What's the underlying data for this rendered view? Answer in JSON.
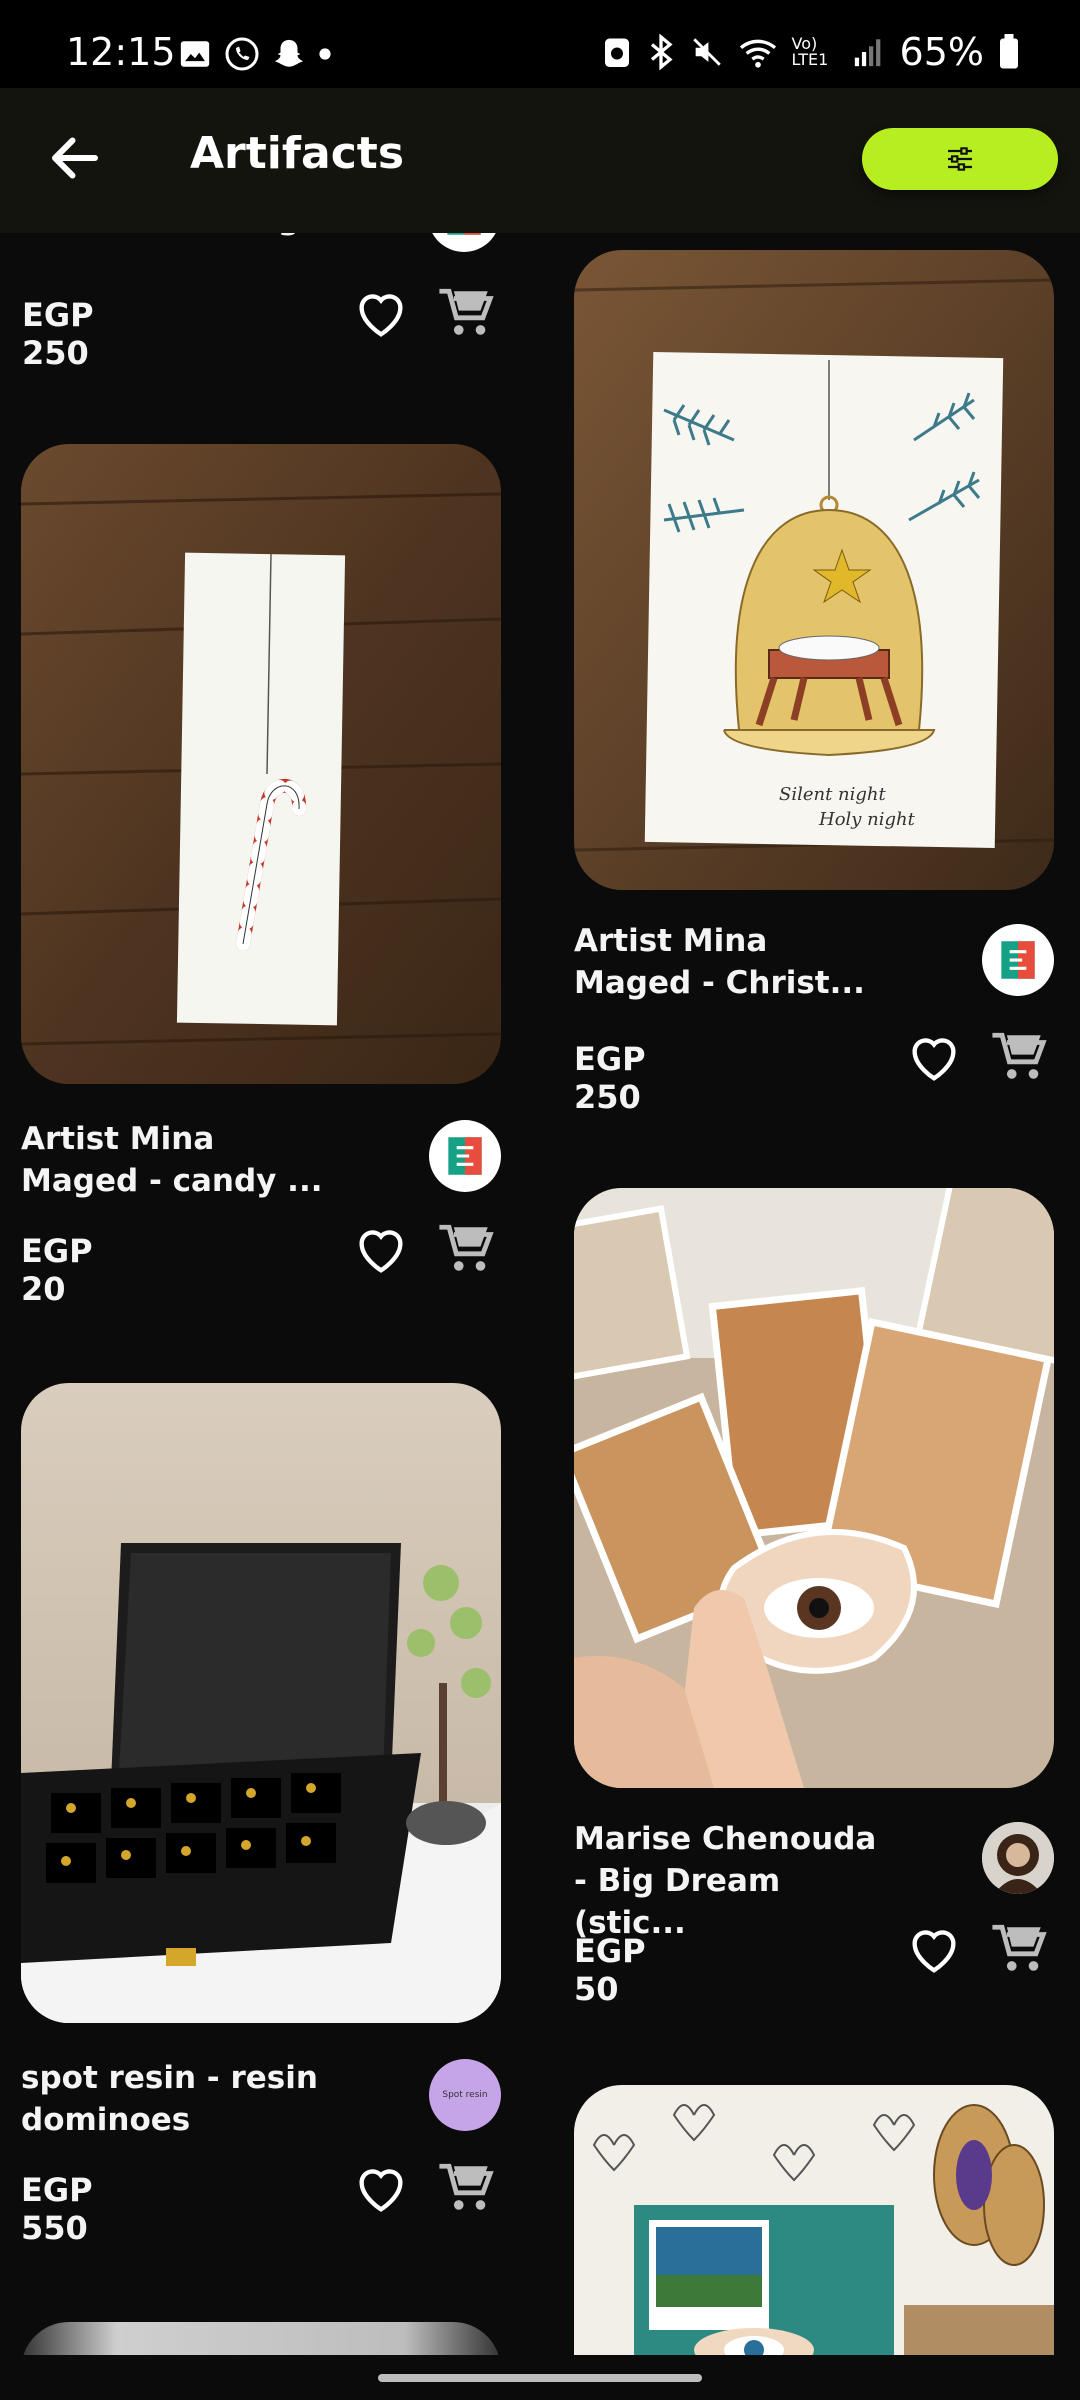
{
  "status_bar": {
    "time": "12:15",
    "battery": "65%",
    "network": "Vo) LTE1"
  },
  "app_bar": {
    "title": "Artifacts"
  },
  "products": [
    {
      "name": "Artist Mina Maged  - Christ...",
      "price": "EGP 250"
    },
    {
      "name": "Artist Mina Maged  - candy ...",
      "price": "EGP 20"
    },
    {
      "name": "spot resin  - resin dominoes",
      "price": "EGP 550"
    },
    {
      "name": "Artist Mina Maged  - Christ...",
      "price": "EGP 250"
    },
    {
      "name": "Marise Chenouda  - Big Dream (stic...",
      "price": "EGP 50"
    }
  ],
  "avatars": {
    "spot_resin_text": "Spot resin"
  },
  "colors": {
    "accent": "#b7ee22",
    "background": "#0b0b0b"
  }
}
